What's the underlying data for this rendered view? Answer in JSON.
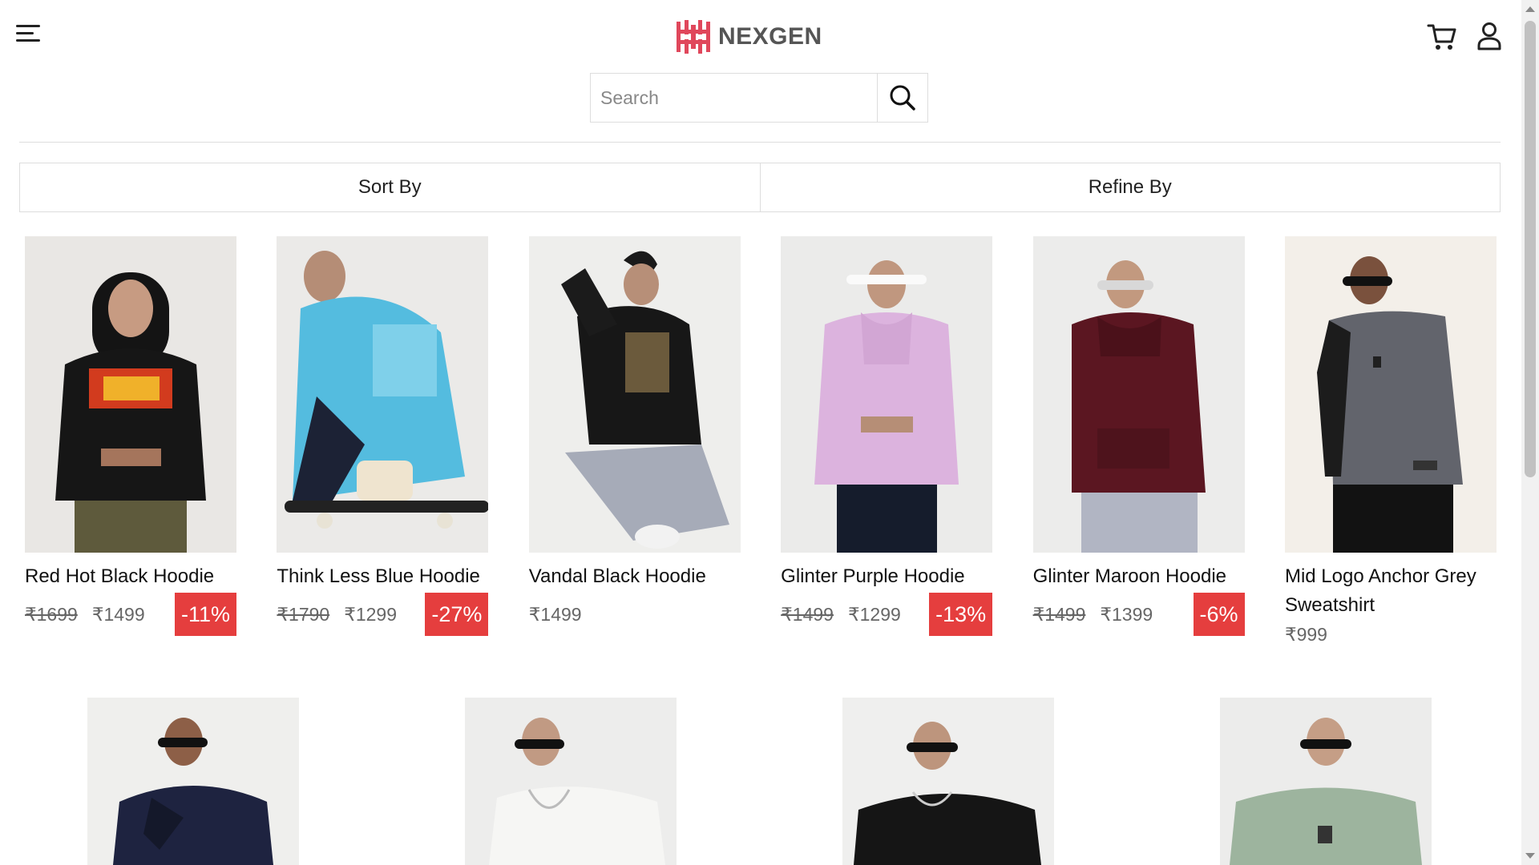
{
  "header": {
    "brand": "NEXGEN",
    "brand_color": "#e0475b",
    "icons": [
      "menu-icon",
      "cart-icon",
      "user-icon"
    ]
  },
  "search": {
    "placeholder": "Search",
    "value": "",
    "icon": "search-icon"
  },
  "filters": {
    "sort_label": "Sort By",
    "refine_label": "Refine By"
  },
  "products": [
    {
      "name": "Red Hot Black Hoodie",
      "mrp": "₹1699",
      "price": "₹1499",
      "discount": "-11%",
      "image": "black hoodie with red graphic"
    },
    {
      "name": "Think Less Blue Hoodie",
      "mrp": "₹1790",
      "price": "₹1299",
      "discount": "-27%",
      "image": "light blue hoodie on skateboard"
    },
    {
      "name": "Vandal Black Hoodie",
      "mrp": "",
      "price": "₹1499",
      "discount": "",
      "image": "black hoodie with back print"
    },
    {
      "name": "Glinter Purple Hoodie",
      "mrp": "₹1499",
      "price": "₹1299",
      "discount": "-13%",
      "image": "lilac hoodie"
    },
    {
      "name": "Glinter Maroon Hoodie",
      "mrp": "₹1499",
      "price": "₹1399",
      "discount": "-6%",
      "image": "maroon hoodie"
    },
    {
      "name": "Mid Logo Anchor Grey Sweatshirt",
      "mrp": "",
      "price": "₹999",
      "discount": "",
      "image": "grey sweatshirt"
    }
  ],
  "products_row2": [
    {
      "image": "navy sweatshirt"
    },
    {
      "image": "white sweatshirt"
    },
    {
      "image": "black sweatshirt"
    },
    {
      "image": "sage green sweatshirt"
    }
  ],
  "colors": {
    "discount_badge": "#e53e3e",
    "border": "#dddddd"
  }
}
